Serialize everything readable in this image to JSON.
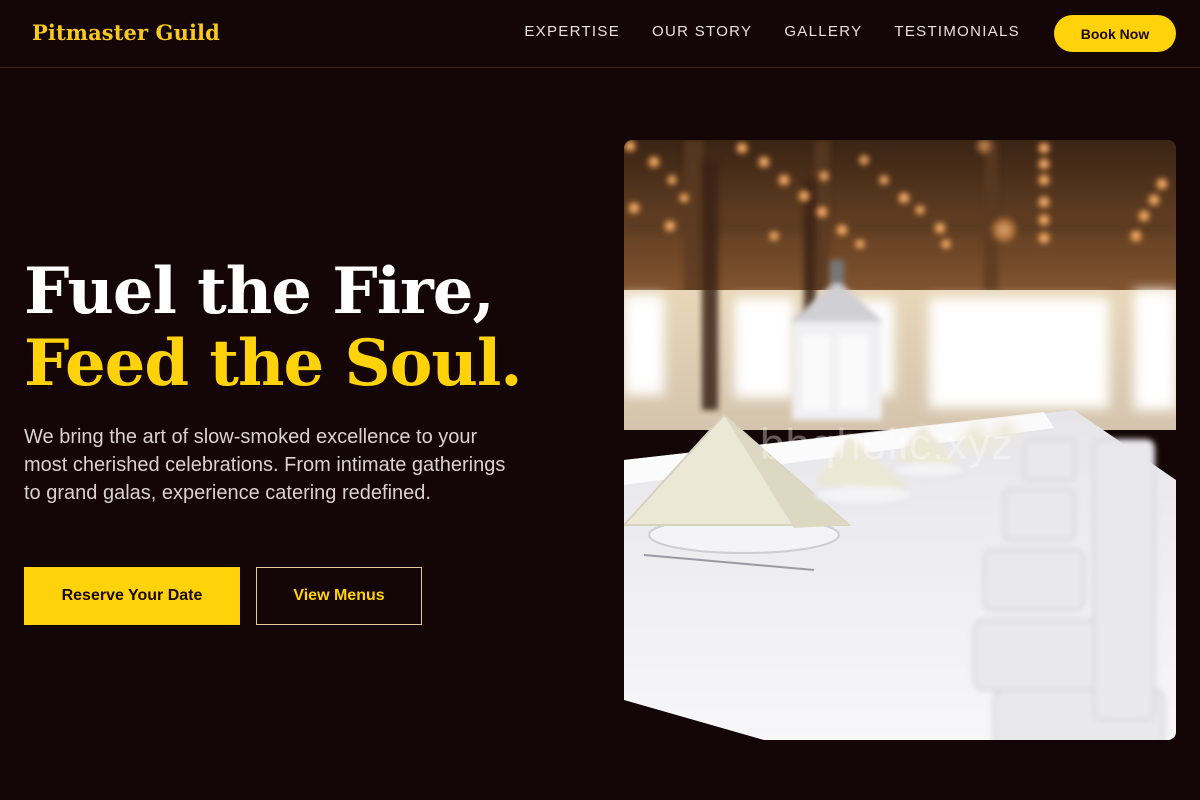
{
  "header": {
    "brand": "Pitmaster Guild",
    "nav": [
      "EXPERTISE",
      "OUR STORY",
      "GALLERY",
      "TESTIMONIALS"
    ],
    "cta_label": "Book Now"
  },
  "hero": {
    "title_line1": "Fuel the Fire,",
    "title_line2": "Feed the Soul.",
    "description": "We bring the art of slow-smoked excellence to your most cherished celebrations. From intimate gatherings to grand galas, experience catering redefined.",
    "primary_button": "Reserve Your Date",
    "secondary_button": "View Menus"
  },
  "image": {
    "watermark": "bbqholic.xyz"
  },
  "colors": {
    "background": "#140506",
    "accent": "#ffd20a",
    "text": "#ffffff"
  }
}
